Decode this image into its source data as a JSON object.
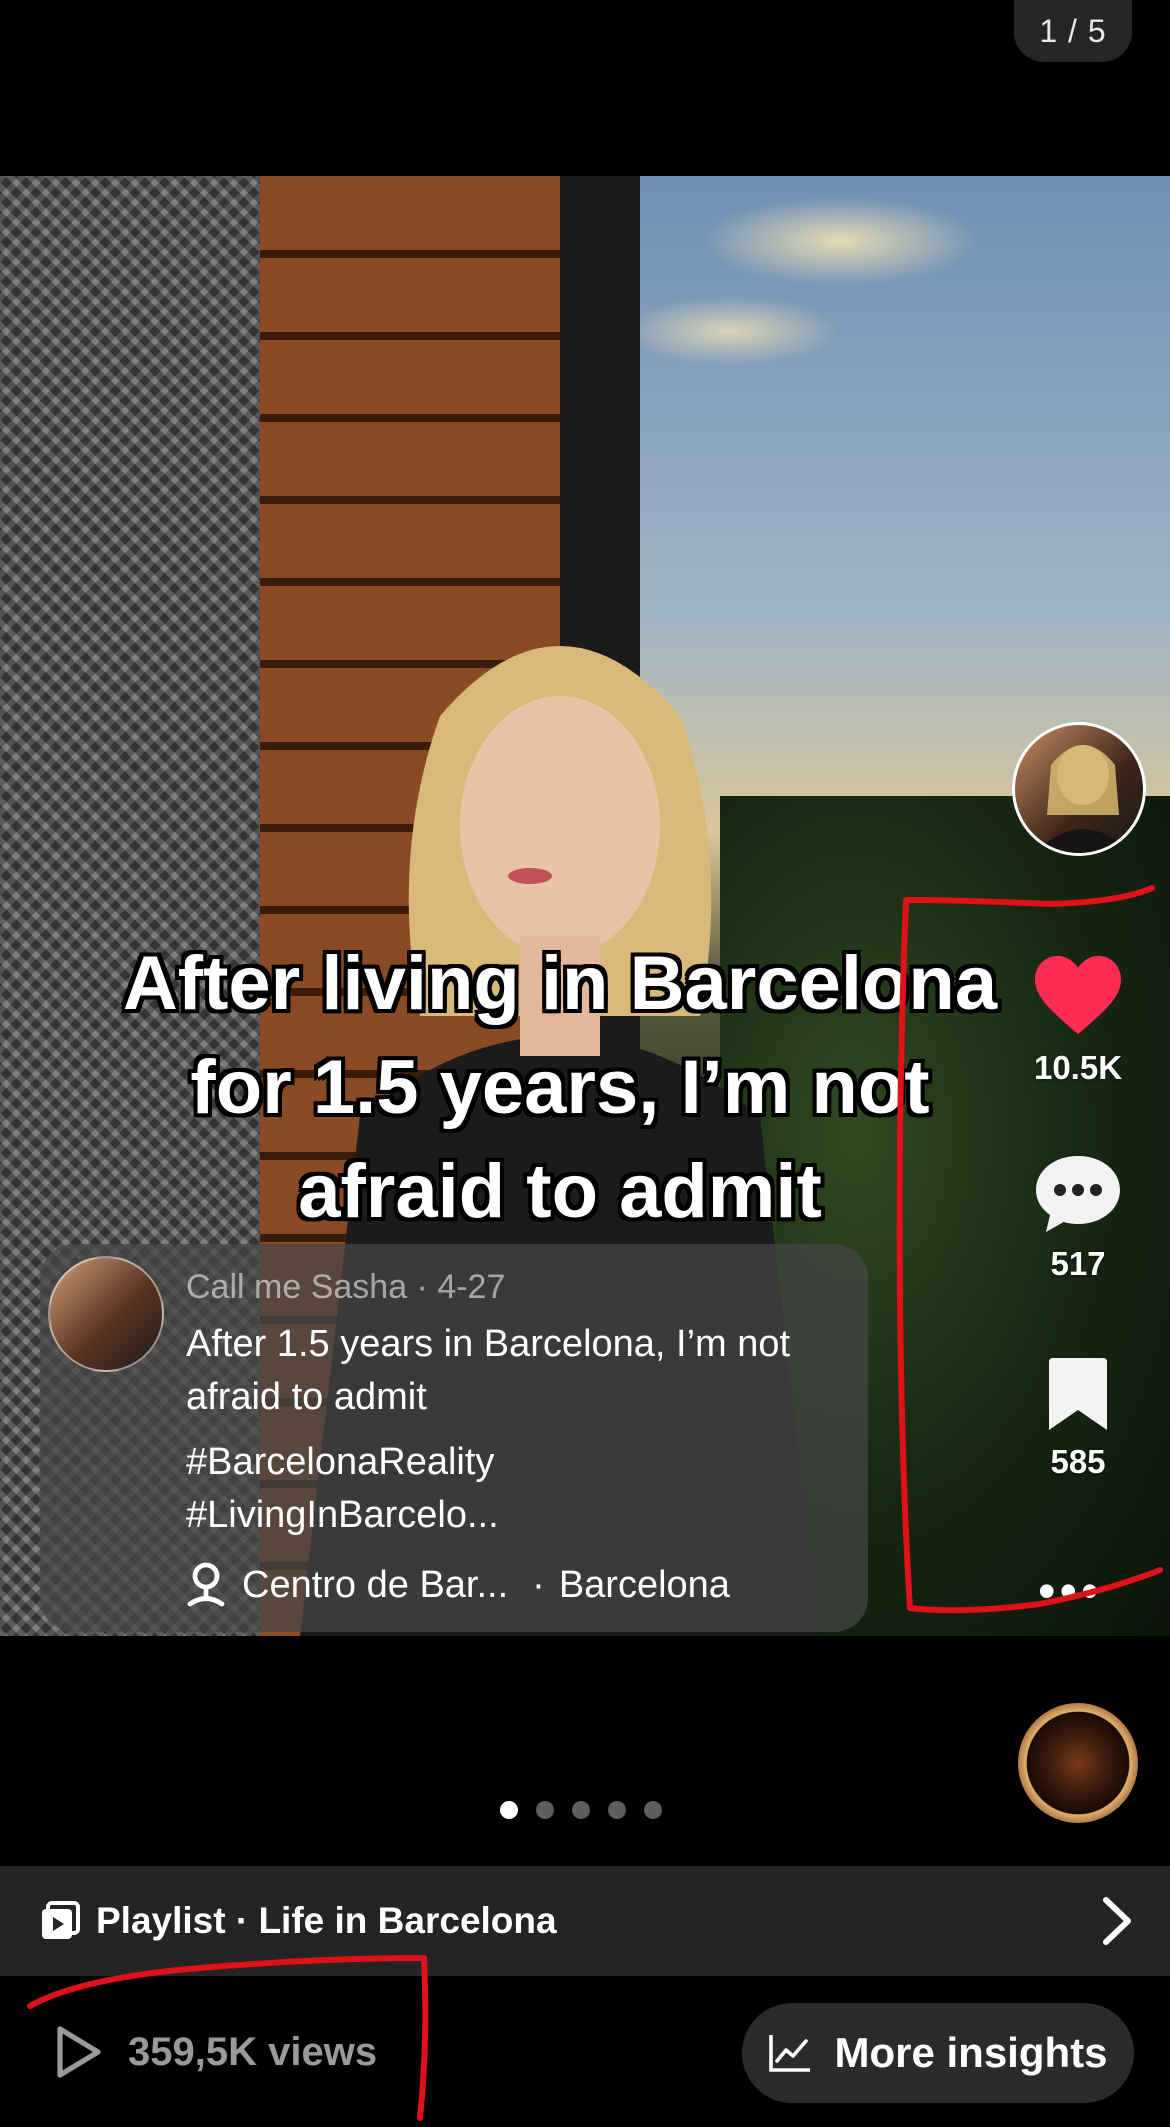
{
  "header": {
    "page_counter": "1 / 5"
  },
  "post": {
    "overlay_lines": [
      "After living in Barcelona",
      "for 1.5 years, I’m not",
      "afraid to admit"
    ],
    "author": "Call me Sasha · 4-27",
    "description": "After 1.5 years in Barcelona, I’m not afraid to admit",
    "hashtags": [
      "#BarcelonaReality",
      "#LivingInBarcelo..."
    ],
    "location": {
      "place": "Centro de Bar...",
      "separator": "·",
      "city": "Barcelona",
      "icon": "location-pin-icon"
    }
  },
  "actions": {
    "likes": {
      "count": "10.5K",
      "icon": "heart-icon",
      "color": "#fe2c55"
    },
    "comments": {
      "count": "517",
      "icon": "comment-bubble-icon"
    },
    "saves": {
      "count": "585",
      "icon": "bookmark-icon"
    },
    "more": {
      "label": "•••"
    }
  },
  "carousel": {
    "total": 5,
    "active": 1
  },
  "playlist": {
    "label": "Playlist · Life in Barcelona",
    "icon": "playlist-icon"
  },
  "stats": {
    "views": "359,5K views",
    "views_icon": "play-outline-icon",
    "insights_label": "More insights",
    "insights_icon": "line-chart-icon"
  },
  "annotation_color": "#e0111a"
}
